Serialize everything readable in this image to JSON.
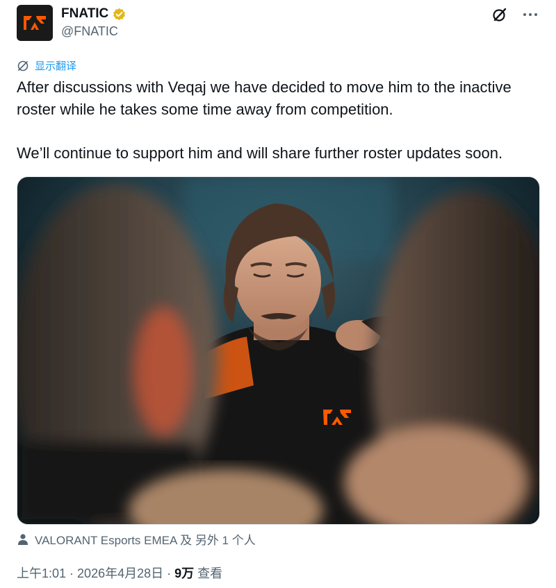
{
  "author": {
    "display_name": "FNATIC",
    "handle": "@FNATIC",
    "avatar_icon": "fnatic-logo-icon",
    "verified_icon": "verified-badge-icon",
    "brand_color": "#ff5900"
  },
  "actions": {
    "grok_icon": "grok-icon",
    "more_icon": "more-dots-icon"
  },
  "translate": {
    "label": "显示翻译",
    "icon": "translate-globe-icon"
  },
  "tweet": {
    "paragraphs": [
      "After discussions with Veqaj we have decided to move him to the inactive roster while he takes some time away from competition.",
      "We’ll continue to support him and will share further roster updates soon."
    ]
  },
  "media": {
    "type": "photo",
    "icon": "photo-player-in-fnatic-jersey"
  },
  "tagged": {
    "icon": "person-icon",
    "text": "VALORANT Esports EMEA 及 另外 1 个人"
  },
  "meta": {
    "time": "上午1:01",
    "separator": "·",
    "date": "2026年4月28日",
    "views_count": "9万",
    "views_label": "查看"
  },
  "colors": {
    "text_primary": "#0f1419",
    "text_secondary": "#536471",
    "link": "#1d9bf0",
    "verified_gold": "#e2b719"
  }
}
